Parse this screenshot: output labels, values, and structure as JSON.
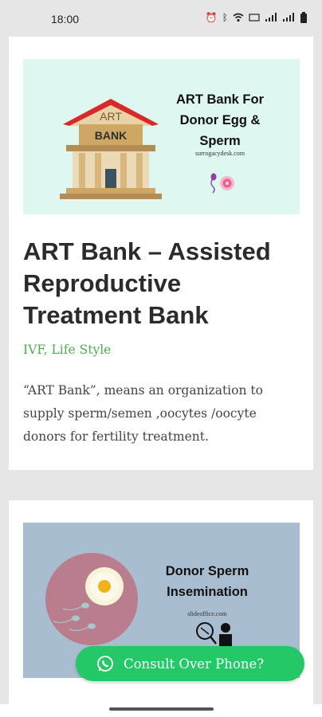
{
  "status_bar": {
    "time": "18:00"
  },
  "post1": {
    "banner": {
      "title_lines": [
        "ART Bank For",
        "Donor Egg &",
        "Sperm"
      ],
      "site": "surrogacydesk.com",
      "roof_label": "ART",
      "building_label": "BANK"
    },
    "title": "ART Bank – Assisted Reproductive Treatment Bank",
    "categories": "IVF, Life Style",
    "excerpt": "“ART Bank”, means an organization to supply sperm/semen ,oocytes /oocyte donors for fertility treatment."
  },
  "post2": {
    "banner": {
      "title_lines": [
        "Donor Sperm",
        "Insemination"
      ],
      "site": "slideoffice.com"
    }
  },
  "fab": {
    "label": "Consult Over Phone?"
  },
  "colors": {
    "accent_green": "#4caf50",
    "fab_green": "#25c866"
  }
}
